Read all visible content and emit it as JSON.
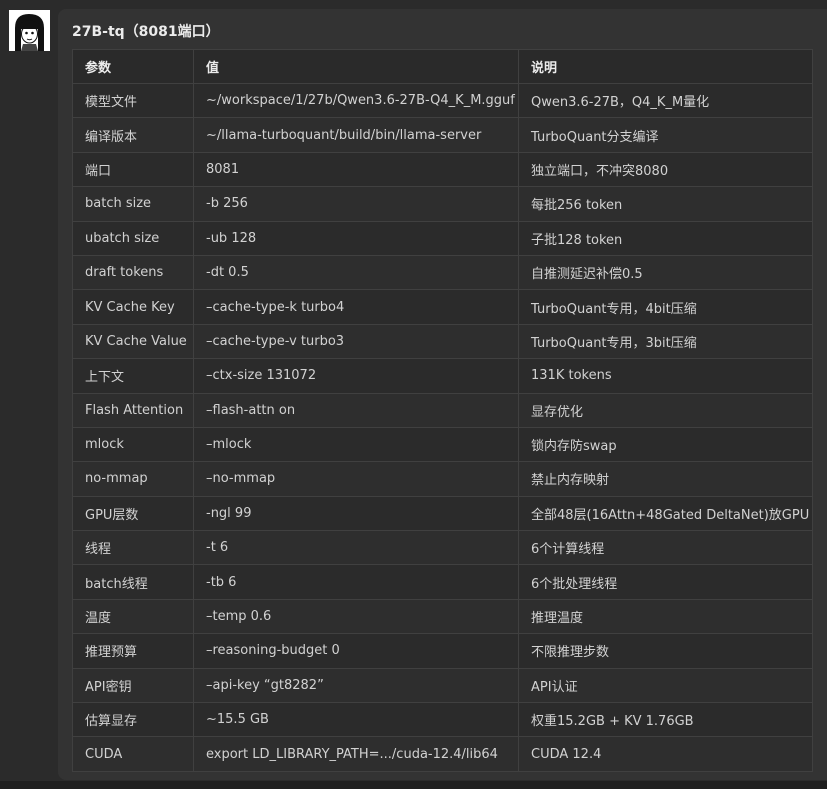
{
  "card": {
    "title": "27B-tq（8081端口）"
  },
  "table": {
    "headers": [
      "参数",
      "值",
      "说明"
    ],
    "rows": [
      {
        "param": "模型文件",
        "value": "~/workspace/1/27b/Qwen3.6-27B-Q4_K_M.gguf",
        "desc": "Qwen3.6-27B，Q4_K_M量化"
      },
      {
        "param": "编译版本",
        "value": "~/llama-turboquant/build/bin/llama-server",
        "desc": "TurboQuant分支编译"
      },
      {
        "param": "端口",
        "value": "8081",
        "desc": "独立端口，不冲突8080"
      },
      {
        "param": "batch size",
        "value": "-b 256",
        "desc": "每批256 token"
      },
      {
        "param": "ubatch size",
        "value": "-ub 128",
        "desc": "子批128 token"
      },
      {
        "param": "draft tokens",
        "value": "-dt 0.5",
        "desc": "自推测延迟补偿0.5"
      },
      {
        "param": "KV Cache Key",
        "value": "–cache-type-k turbo4",
        "desc": "TurboQuant专用，4bit压缩"
      },
      {
        "param": "KV Cache Value",
        "value": "–cache-type-v turbo3",
        "desc": "TurboQuant专用，3bit压缩"
      },
      {
        "param": "上下文",
        "value": "–ctx-size 131072",
        "desc": "131K tokens"
      },
      {
        "param": "Flash Attention",
        "value": "–flash-attn on",
        "desc": "显存优化"
      },
      {
        "param": "mlock",
        "value": "–mlock",
        "desc": "锁内存防swap"
      },
      {
        "param": "no-mmap",
        "value": "–no-mmap",
        "desc": "禁止内存映射"
      },
      {
        "param": "GPU层数",
        "value": "-ngl 99",
        "desc": "全部48层(16Attn+48Gated DeltaNet)放GPU"
      },
      {
        "param": "线程",
        "value": "-t 6",
        "desc": "6个计算线程"
      },
      {
        "param": "batch线程",
        "value": "-tb 6",
        "desc": "6个批处理线程"
      },
      {
        "param": "温度",
        "value": "–temp 0.6",
        "desc": "推理温度"
      },
      {
        "param": "推理预算",
        "value": "–reasoning-budget 0",
        "desc": "不限推理步数"
      },
      {
        "param": "API密钥",
        "value": "–api-key “gt8282”",
        "desc": "API认证"
      },
      {
        "param": "估算显存",
        "value": "~15.5 GB",
        "desc": "权重15.2GB + KV 1.76GB"
      },
      {
        "param": "CUDA",
        "value": "export LD_LIBRARY_PATH=.../cuda-12.4/lib64",
        "desc": "CUDA 12.4"
      }
    ]
  },
  "colors": {
    "page_bg": "#2b2b2b",
    "card_bg": "#333333",
    "header_text": "#ececec",
    "cell_text": "#d2d2d2",
    "border": "#404040"
  }
}
